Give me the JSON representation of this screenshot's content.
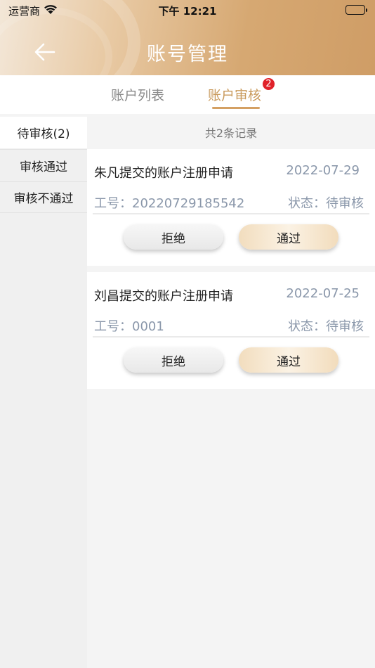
{
  "status_bar": {
    "carrier": "运营商",
    "time": "下午 12:21"
  },
  "nav": {
    "title": "账号管理"
  },
  "tabs": [
    {
      "label": "账户列表",
      "active": false
    },
    {
      "label": "账户审核",
      "active": true,
      "badge": "2"
    }
  ],
  "sidebar": {
    "items": [
      {
        "label": "待审核(2)",
        "active": true
      },
      {
        "label": "审核通过",
        "active": false
      },
      {
        "label": "审核不通过",
        "active": false
      }
    ]
  },
  "records_summary": "共2条记录",
  "cards": [
    {
      "title": "朱凡提交的账户注册申请",
      "date": "2022-07-29",
      "employee_no": "工号：20220729185542",
      "status": "状态：待审核",
      "reject_label": "拒绝",
      "approve_label": "通过"
    },
    {
      "title": "刘昌提交的账户注册申请",
      "date": "2022-07-25",
      "employee_no": "工号：0001",
      "status": "状态：待审核",
      "reject_label": "拒绝",
      "approve_label": "通过"
    }
  ],
  "colors": {
    "accent": "#d4a063",
    "badge": "#e0222a",
    "meta_text": "#8a97aa"
  }
}
